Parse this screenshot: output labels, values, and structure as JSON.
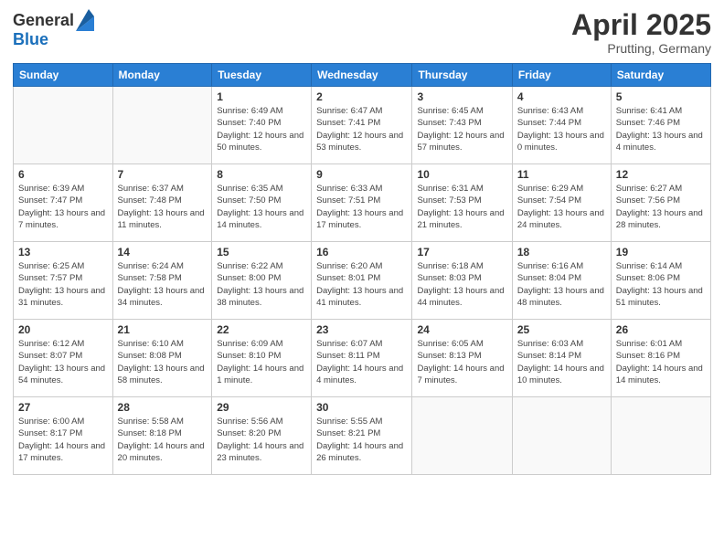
{
  "header": {
    "logo_general": "General",
    "logo_blue": "Blue",
    "title": "April 2025",
    "location": "Prutting, Germany"
  },
  "weekdays": [
    "Sunday",
    "Monday",
    "Tuesday",
    "Wednesday",
    "Thursday",
    "Friday",
    "Saturday"
  ],
  "weeks": [
    [
      {
        "day": "",
        "info": ""
      },
      {
        "day": "",
        "info": ""
      },
      {
        "day": "1",
        "info": "Sunrise: 6:49 AM\nSunset: 7:40 PM\nDaylight: 12 hours and 50 minutes."
      },
      {
        "day": "2",
        "info": "Sunrise: 6:47 AM\nSunset: 7:41 PM\nDaylight: 12 hours and 53 minutes."
      },
      {
        "day": "3",
        "info": "Sunrise: 6:45 AM\nSunset: 7:43 PM\nDaylight: 12 hours and 57 minutes."
      },
      {
        "day": "4",
        "info": "Sunrise: 6:43 AM\nSunset: 7:44 PM\nDaylight: 13 hours and 0 minutes."
      },
      {
        "day": "5",
        "info": "Sunrise: 6:41 AM\nSunset: 7:46 PM\nDaylight: 13 hours and 4 minutes."
      }
    ],
    [
      {
        "day": "6",
        "info": "Sunrise: 6:39 AM\nSunset: 7:47 PM\nDaylight: 13 hours and 7 minutes."
      },
      {
        "day": "7",
        "info": "Sunrise: 6:37 AM\nSunset: 7:48 PM\nDaylight: 13 hours and 11 minutes."
      },
      {
        "day": "8",
        "info": "Sunrise: 6:35 AM\nSunset: 7:50 PM\nDaylight: 13 hours and 14 minutes."
      },
      {
        "day": "9",
        "info": "Sunrise: 6:33 AM\nSunset: 7:51 PM\nDaylight: 13 hours and 17 minutes."
      },
      {
        "day": "10",
        "info": "Sunrise: 6:31 AM\nSunset: 7:53 PM\nDaylight: 13 hours and 21 minutes."
      },
      {
        "day": "11",
        "info": "Sunrise: 6:29 AM\nSunset: 7:54 PM\nDaylight: 13 hours and 24 minutes."
      },
      {
        "day": "12",
        "info": "Sunrise: 6:27 AM\nSunset: 7:56 PM\nDaylight: 13 hours and 28 minutes."
      }
    ],
    [
      {
        "day": "13",
        "info": "Sunrise: 6:25 AM\nSunset: 7:57 PM\nDaylight: 13 hours and 31 minutes."
      },
      {
        "day": "14",
        "info": "Sunrise: 6:24 AM\nSunset: 7:58 PM\nDaylight: 13 hours and 34 minutes."
      },
      {
        "day": "15",
        "info": "Sunrise: 6:22 AM\nSunset: 8:00 PM\nDaylight: 13 hours and 38 minutes."
      },
      {
        "day": "16",
        "info": "Sunrise: 6:20 AM\nSunset: 8:01 PM\nDaylight: 13 hours and 41 minutes."
      },
      {
        "day": "17",
        "info": "Sunrise: 6:18 AM\nSunset: 8:03 PM\nDaylight: 13 hours and 44 minutes."
      },
      {
        "day": "18",
        "info": "Sunrise: 6:16 AM\nSunset: 8:04 PM\nDaylight: 13 hours and 48 minutes."
      },
      {
        "day": "19",
        "info": "Sunrise: 6:14 AM\nSunset: 8:06 PM\nDaylight: 13 hours and 51 minutes."
      }
    ],
    [
      {
        "day": "20",
        "info": "Sunrise: 6:12 AM\nSunset: 8:07 PM\nDaylight: 13 hours and 54 minutes."
      },
      {
        "day": "21",
        "info": "Sunrise: 6:10 AM\nSunset: 8:08 PM\nDaylight: 13 hours and 58 minutes."
      },
      {
        "day": "22",
        "info": "Sunrise: 6:09 AM\nSunset: 8:10 PM\nDaylight: 14 hours and 1 minute."
      },
      {
        "day": "23",
        "info": "Sunrise: 6:07 AM\nSunset: 8:11 PM\nDaylight: 14 hours and 4 minutes."
      },
      {
        "day": "24",
        "info": "Sunrise: 6:05 AM\nSunset: 8:13 PM\nDaylight: 14 hours and 7 minutes."
      },
      {
        "day": "25",
        "info": "Sunrise: 6:03 AM\nSunset: 8:14 PM\nDaylight: 14 hours and 10 minutes."
      },
      {
        "day": "26",
        "info": "Sunrise: 6:01 AM\nSunset: 8:16 PM\nDaylight: 14 hours and 14 minutes."
      }
    ],
    [
      {
        "day": "27",
        "info": "Sunrise: 6:00 AM\nSunset: 8:17 PM\nDaylight: 14 hours and 17 minutes."
      },
      {
        "day": "28",
        "info": "Sunrise: 5:58 AM\nSunset: 8:18 PM\nDaylight: 14 hours and 20 minutes."
      },
      {
        "day": "29",
        "info": "Sunrise: 5:56 AM\nSunset: 8:20 PM\nDaylight: 14 hours and 23 minutes."
      },
      {
        "day": "30",
        "info": "Sunrise: 5:55 AM\nSunset: 8:21 PM\nDaylight: 14 hours and 26 minutes."
      },
      {
        "day": "",
        "info": ""
      },
      {
        "day": "",
        "info": ""
      },
      {
        "day": "",
        "info": ""
      }
    ]
  ]
}
